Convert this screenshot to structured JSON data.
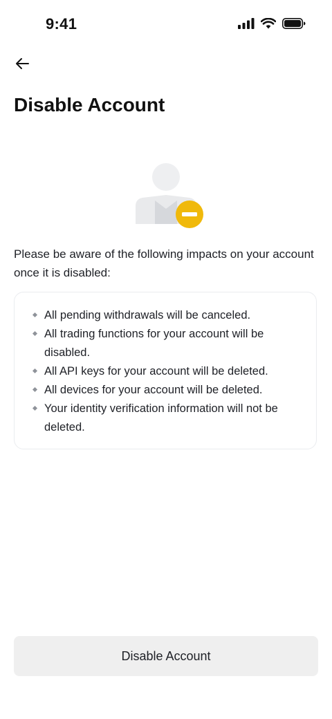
{
  "status_bar": {
    "time": "9:41",
    "icons": [
      "cellular-signal-icon",
      "wifi-icon",
      "battery-icon"
    ]
  },
  "header": {
    "back_icon": "arrow-left-icon",
    "title": "Disable Account"
  },
  "illustration": {
    "icon": "user-disabled-icon",
    "accent_color": "#F0B90B"
  },
  "intro_text": "Please be aware of the following impacts on your account once it is disabled:",
  "impacts": [
    "All pending withdrawals will be canceled.",
    "All trading functions for your account will be disabled.",
    "All API keys for your account will be deleted.",
    "All devices for your account will be deleted.",
    "Your identity verification information will not be deleted."
  ],
  "actions": {
    "disable_label": "Disable Account"
  }
}
